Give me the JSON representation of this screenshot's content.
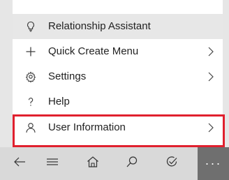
{
  "menu": {
    "items": [
      {
        "label": "Relationship Assistant",
        "icon": "lightbulb-icon",
        "has_chevron": false
      },
      {
        "label": "Quick Create Menu",
        "icon": "plus-icon",
        "has_chevron": true
      },
      {
        "label": "Settings",
        "icon": "gear-icon",
        "has_chevron": true
      },
      {
        "label": "Help",
        "icon": "question-icon",
        "has_chevron": false
      },
      {
        "label": "User Information",
        "icon": "person-icon",
        "has_chevron": true
      }
    ]
  },
  "bottom_nav": {
    "items": [
      "back-arrow-icon",
      "hamburger-menu-icon",
      "home-icon",
      "search-icon",
      "check-circle-icon",
      "more-icon"
    ],
    "more_label": "···"
  },
  "colors": {
    "highlight": "#e7e7e7",
    "selection": "#e0202e",
    "bottom_bar": "#d9d9d9",
    "more_button": "#6f6f6f"
  }
}
